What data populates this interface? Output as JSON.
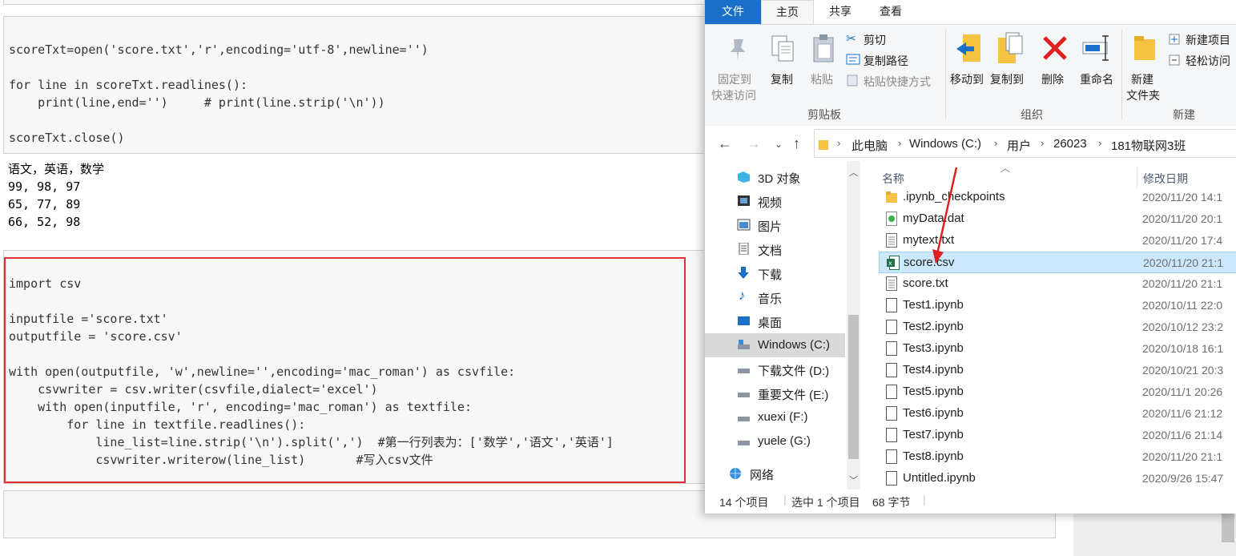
{
  "notebook": {
    "cell1_code": [
      "scoreTxt=open('score.txt','r',encoding='utf-8',newline='')",
      "",
      "for line in scoreTxt.readlines():",
      "    print(line,end='')     # print(line.strip('\\n'))",
      "",
      "scoreTxt.close()"
    ],
    "cell1_output": [
      "语文，英语，数学",
      "99, 98, 97",
      "65, 77, 89",
      "66, 52, 98"
    ],
    "cell2_code": [
      "import csv",
      "",
      "inputfile ='score.txt'",
      "outputfile = 'score.csv'",
      "",
      "with open(outputfile, 'w',newline='',encoding='mac_roman') as csvfile:",
      "    csvwriter = csv.writer(csvfile,dialect='excel')",
      "    with open(inputfile, 'r', encoding='mac_roman') as textfile:",
      "        for line in textfile.readlines():",
      "            line_list=line.strip('\\n').split(',')  #第一行列表为：['数学','语文','英语']",
      "            csvwriter.writerow(line_list)       #写入csv文件"
    ]
  },
  "explorer": {
    "tabs": {
      "file": "文件",
      "home": "主页",
      "share": "共享",
      "view": "查看"
    },
    "ribbon": {
      "pin_label_1": "固定到",
      "pin_label_2": "快速访问",
      "copy": "复制",
      "paste": "粘贴",
      "cut": "剪切",
      "copy_path": "复制路径",
      "paste_shortcut": "粘贴快捷方式",
      "clipboard_group": "剪贴板",
      "move_to": "移动到",
      "copy_to": "复制到",
      "delete": "删除",
      "rename": "重命名",
      "organize_group": "组织",
      "new_folder_1": "新建",
      "new_folder_2": "文件夹",
      "new_item": "新建项目",
      "easy_access": "轻松访问",
      "new_group": "新建"
    },
    "breadcrumb": [
      "此电脑",
      "Windows (C:)",
      "用户",
      "26023",
      "181物联网3班"
    ],
    "nav_items": [
      {
        "label": "3D 对象",
        "icon": "3d-objects-icon"
      },
      {
        "label": "视频",
        "icon": "video-icon"
      },
      {
        "label": "图片",
        "icon": "pictures-icon"
      },
      {
        "label": "文档",
        "icon": "documents-icon"
      },
      {
        "label": "下载",
        "icon": "download-icon"
      },
      {
        "label": "音乐",
        "icon": "music-icon"
      },
      {
        "label": "桌面",
        "icon": "desktop-icon"
      },
      {
        "label": "Windows (C:)",
        "icon": "drive-icon",
        "selected": true
      },
      {
        "label": "下载文件 (D:)",
        "icon": "drive-icon"
      },
      {
        "label": "重要文件 (E:)",
        "icon": "drive-icon"
      },
      {
        "label": "xuexi (F:)",
        "icon": "drive-icon"
      },
      {
        "label": "yuele (G:)",
        "icon": "drive-icon"
      },
      {
        "label": "网络",
        "icon": "network-icon"
      }
    ],
    "columns": {
      "name": "名称",
      "modified": "修改日期"
    },
    "files": [
      {
        "name": ".ipynb_checkpoints",
        "date": "2020/11/20 14:1",
        "icon": "folder-icon"
      },
      {
        "name": "myData.dat",
        "date": "2020/11/20 20:1",
        "icon": "media-file-icon"
      },
      {
        "name": "mytext.txt",
        "date": "2020/11/20 17:4",
        "icon": "text-file-icon"
      },
      {
        "name": "score.csv",
        "date": "2020/11/20 21:1",
        "icon": "excel-file-icon",
        "selected": true
      },
      {
        "name": "score.txt",
        "date": "2020/11/20 21:1",
        "icon": "text-file-icon"
      },
      {
        "name": "Test1.ipynb",
        "date": "2020/10/11 22:0",
        "icon": "file-icon"
      },
      {
        "name": "Test2.ipynb",
        "date": "2020/10/12 23:2",
        "icon": "file-icon"
      },
      {
        "name": "Test3.ipynb",
        "date": "2020/10/18 16:1",
        "icon": "file-icon"
      },
      {
        "name": "Test4.ipynb",
        "date": "2020/10/21 20:3",
        "icon": "file-icon"
      },
      {
        "name": "Test5.ipynb",
        "date": "2020/11/1 20:26",
        "icon": "file-icon"
      },
      {
        "name": "Test6.ipynb",
        "date": "2020/11/6 21:12",
        "icon": "file-icon"
      },
      {
        "name": "Test7.ipynb",
        "date": "2020/11/6 21:14",
        "icon": "file-icon"
      },
      {
        "name": "Test8.ipynb",
        "date": "2020/11/20 21:1",
        "icon": "file-icon"
      },
      {
        "name": "Untitled.ipynb",
        "date": "2020/9/26 15:47",
        "icon": "file-icon"
      }
    ],
    "status": {
      "count": "14 个项目",
      "selection": "选中 1 个项目",
      "size": "68 字节"
    }
  },
  "colors": {
    "accent": "#1a6fc9",
    "highlight_box": "#e03030",
    "selection": "#cce8ff"
  }
}
